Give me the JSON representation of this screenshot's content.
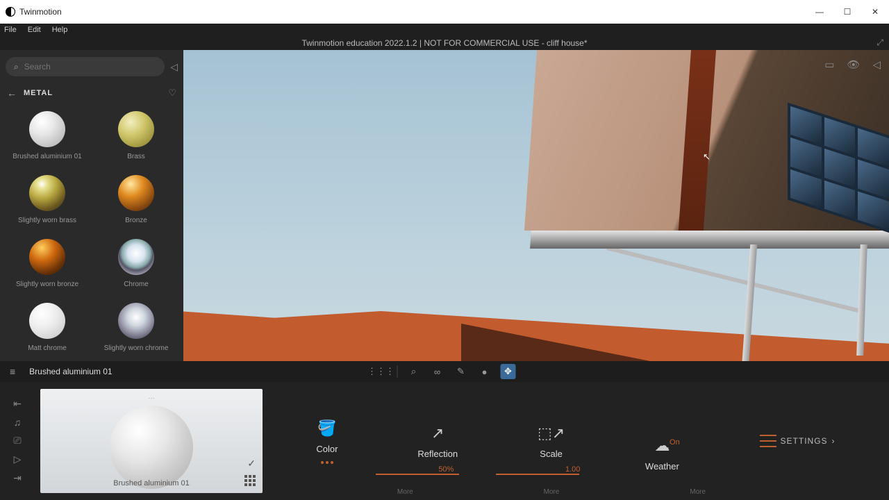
{
  "app_name": "Twinmotion",
  "menu": {
    "file": "File",
    "edit": "Edit",
    "help": "Help"
  },
  "banner": "Twinmotion education 2022.1.2 | NOT FOR COMMERCIAL USE - cliff house*",
  "search": {
    "placeholder": "Search"
  },
  "breadcrumb": {
    "label": "METAL"
  },
  "materials": [
    {
      "name": "Brushed aluminium 01",
      "cls": "sp-aluminium"
    },
    {
      "name": "Brass",
      "cls": "sp-brass"
    },
    {
      "name": "Slightly worn brass",
      "cls": "sp-wornbrass"
    },
    {
      "name": "Bronze",
      "cls": "sp-bronze"
    },
    {
      "name": "Slightly worn bronze",
      "cls": "sp-wornbronze"
    },
    {
      "name": "Chrome",
      "cls": "sp-chrome"
    },
    {
      "name": "Matt chrome",
      "cls": "sp-mattchrome"
    },
    {
      "name": "Slightly worn chrome",
      "cls": "sp-wornchrome"
    }
  ],
  "dock": {
    "title": "Brushed aluminium 01",
    "preview_name": "Brushed aluminium 01",
    "color": "Color",
    "reflection": "Reflection",
    "reflection_val": "50%",
    "scale": "Scale",
    "scale_val": "1.00",
    "weather": "Weather",
    "weather_val": "On",
    "settings": "SETTINGS",
    "more": "More"
  }
}
